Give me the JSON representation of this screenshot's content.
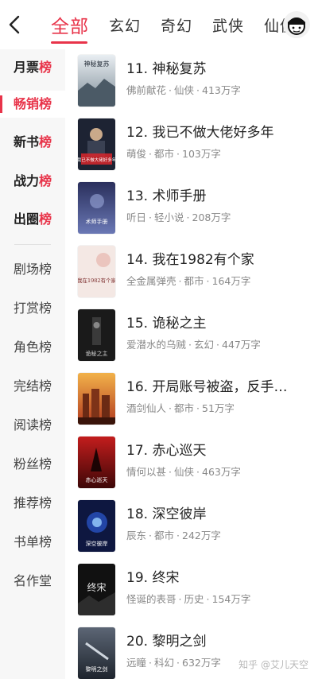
{
  "header": {
    "tabs": [
      {
        "label": "全部",
        "active": true
      },
      {
        "label": "玄幻"
      },
      {
        "label": "奇幻"
      },
      {
        "label": "武侠"
      },
      {
        "label": "仙侠"
      }
    ],
    "back_icon": "chevron-left-icon",
    "avatar_icon": "user-avatar-icon",
    "accent_color": "#e8344a"
  },
  "sidebar": {
    "items": [
      {
        "label": "月票",
        "suffix": "榜",
        "style": "bold"
      },
      {
        "label": "畅销榜",
        "style": "active"
      },
      {
        "label": "新书",
        "suffix": "榜",
        "style": "bold"
      },
      {
        "label": "战力",
        "suffix": "榜",
        "style": "bold"
      },
      {
        "label": "出圈",
        "suffix": "榜",
        "style": "bold"
      },
      {
        "label": "剧场榜"
      },
      {
        "label": "打赏榜"
      },
      {
        "label": "角色榜"
      },
      {
        "label": "完结榜"
      },
      {
        "label": "阅读榜"
      },
      {
        "label": "粉丝榜"
      },
      {
        "label": "推荐榜"
      },
      {
        "label": "书单榜"
      },
      {
        "label": "名作堂"
      }
    ]
  },
  "books": [
    {
      "title": "11. 神秘复苏",
      "author": "佛前献花",
      "genre": "仙侠",
      "words": "413万字",
      "cover_text": "神秘复苏"
    },
    {
      "title": "12. 我已不做大佬好多年",
      "author": "萌俊",
      "genre": "都市",
      "words": "103万字",
      "cover_text": "我已不做大佬好多年"
    },
    {
      "title": "13. 术师手册",
      "author": "听日",
      "genre": "轻小说",
      "words": "208万字",
      "cover_text": "术师手册"
    },
    {
      "title": "14. 我在1982有个家",
      "author": "全金属弹壳",
      "genre": "都市",
      "words": "164万字",
      "cover_text": "我在1982有个家"
    },
    {
      "title": "15. 诡秘之主",
      "author": "爱潜水的乌贼",
      "genre": "玄幻",
      "words": "447万字",
      "cover_text": "诡秘之主"
    },
    {
      "title": "16. 开局账号被盗，反手…",
      "author": "酒剑仙人",
      "genre": "都市",
      "words": "51万字",
      "cover_text": ""
    },
    {
      "title": "17. 赤心巡天",
      "author": "情何以甚",
      "genre": "仙侠",
      "words": "463万字",
      "cover_text": "赤心巡天"
    },
    {
      "title": "18. 深空彼岸",
      "author": "辰东",
      "genre": "都市",
      "words": "242万字",
      "cover_text": "深空彼岸"
    },
    {
      "title": "19. 终宋",
      "author": "怪诞的表哥",
      "genre": "历史",
      "words": "154万字",
      "cover_text": "终宋"
    },
    {
      "title": "20. 黎明之剑",
      "author": "远瞳",
      "genre": "科幻",
      "words": "632万字",
      "cover_text": "黎明之剑"
    }
  ],
  "watermark": "知乎 @艾儿天空"
}
